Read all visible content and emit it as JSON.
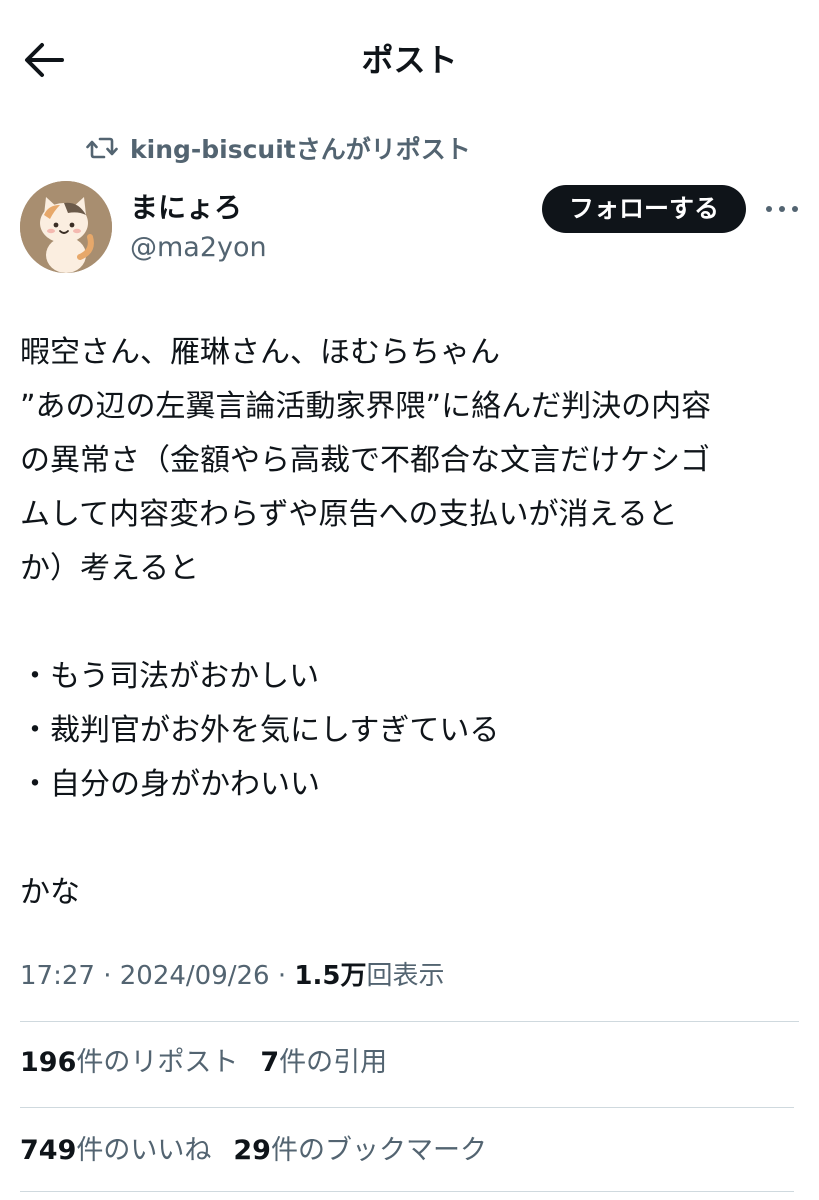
{
  "header": {
    "title": "ポスト",
    "back_icon": "arrow-left-icon"
  },
  "repost": {
    "icon": "repost-icon",
    "text": "king-biscuitさんがリポスト"
  },
  "author": {
    "display_name": "まにょろ",
    "handle": "@ma2yon",
    "avatar_icon": "cat-avatar"
  },
  "follow_button": {
    "label": "フォローする"
  },
  "more_icon": "more-dots-icon",
  "tweet": {
    "lines": [
      "暇空さん、雁琳さん、ほむらちゃん",
      "”あの辺の左翼言論活動家界隈”に絡んだ判決の内容",
      "の異常さ（金額やら高裁で不都合な文言だけケシゴ",
      "ムして内容変わらずや原告への支払いが消えると",
      "か）考えると",
      "",
      "・もう司法がおかしい",
      "・裁判官がお外を気にしすぎている",
      "・自分の身がかわいい",
      "",
      "かな"
    ]
  },
  "meta": {
    "time": "17:27",
    "sep1": " · ",
    "date": "2024/09/26",
    "sep2": " · ",
    "views_count": "1.5万",
    "views_label": "回表示"
  },
  "stats_row1": {
    "reposts_count": "196",
    "reposts_label": "件のリポスト",
    "quotes_count": "7",
    "quotes_label": "件の引用"
  },
  "stats_row2": {
    "likes_count": "749",
    "likes_label": "件のいいね",
    "bookmarks_count": "29",
    "bookmarks_label": "件のブックマーク"
  },
  "colors": {
    "text_primary": "#0f1419",
    "text_secondary": "#536471",
    "divider": "#cfd9de",
    "follow_bg": "#0f1419"
  }
}
